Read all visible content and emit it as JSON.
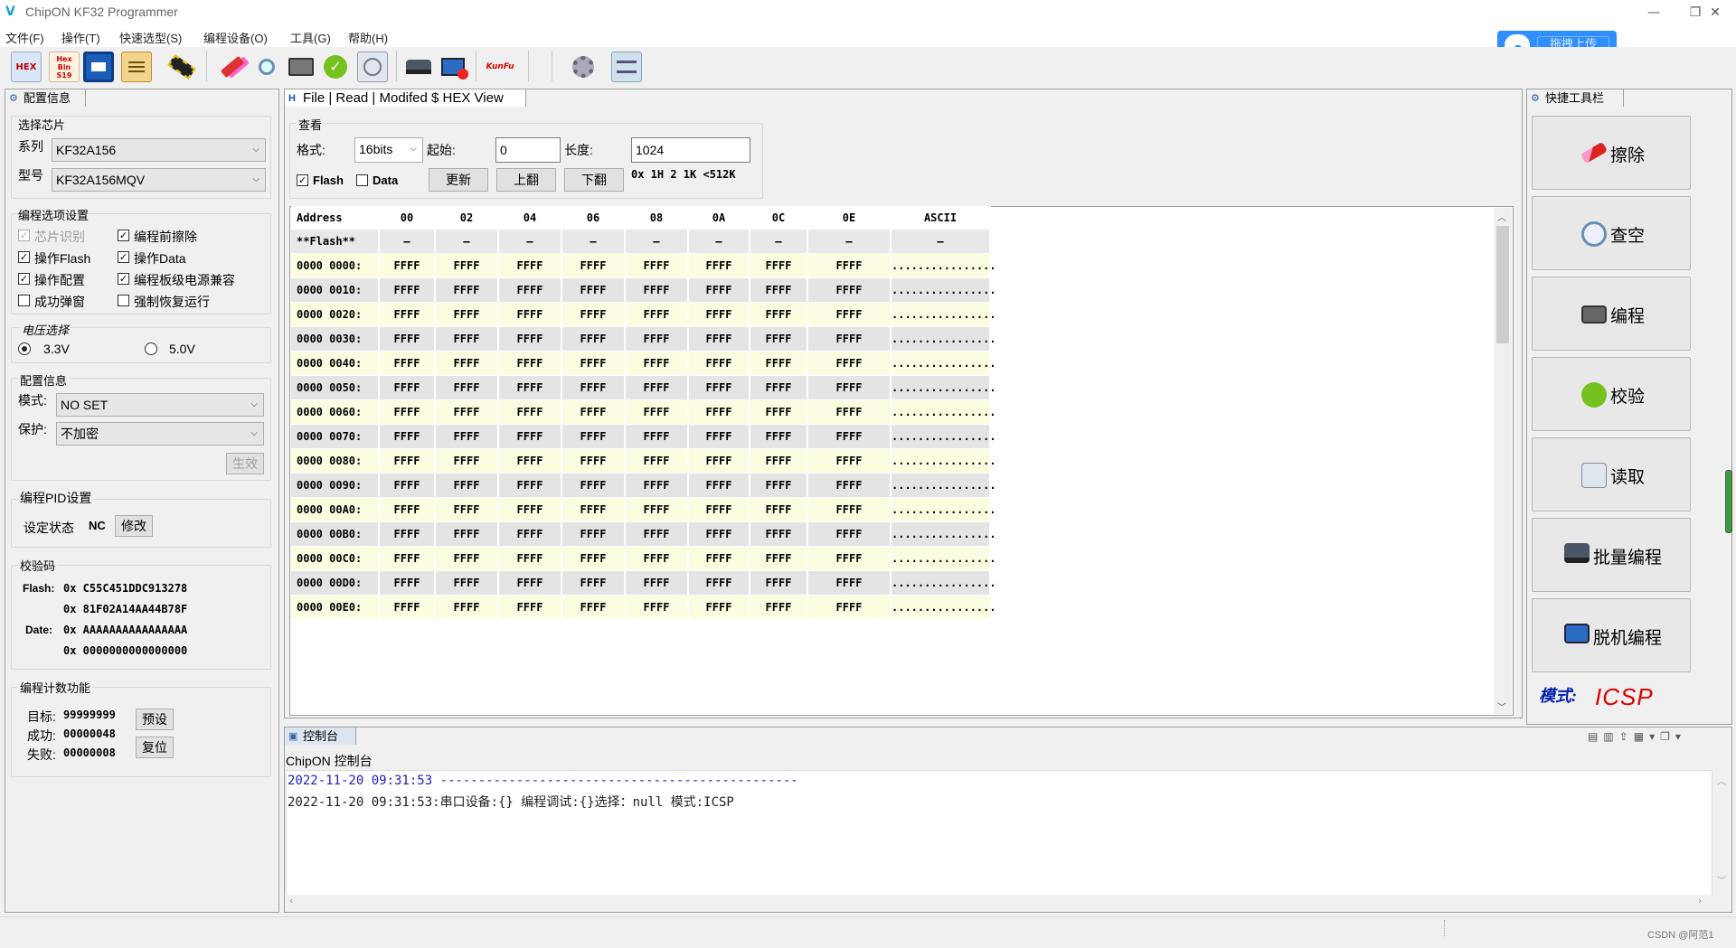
{
  "window": {
    "title": "ChipON KF32 Programmer",
    "minimize": "—",
    "maximize": "❐",
    "close": "✕"
  },
  "menu": [
    "文件(F)",
    "操作(T)",
    "快速选型(S)",
    "编程设备(O)",
    "工具(G)",
    "帮助(H)"
  ],
  "toolbar": {
    "icons": [
      "open-hex-icon",
      "hex-bin-icon",
      "save-icon",
      "report-icon",
      "chip-icon",
      "erase-icon",
      "blank-check-icon",
      "program-icon",
      "verify-icon",
      "read-icon",
      "batch-program-icon",
      "offline-program-icon",
      "kungfu-logo-icon",
      "settings-icon",
      "update-icon"
    ],
    "hex_label": "HEX",
    "hex_bin_label": "Hex Bin S19"
  },
  "upload": {
    "label": "拖拽上传"
  },
  "config": {
    "tab": "配置信息",
    "chip_group": "选择芯片",
    "series_label": "系列",
    "series_value": "KF32A156",
    "model_label": "型号",
    "model_value": "KF32A156MQV",
    "options_group": "编程选项设置",
    "options": [
      {
        "label": "芯片识别",
        "checked": true,
        "disabled": true
      },
      {
        "label": "编程前擦除",
        "checked": true,
        "disabled": false
      },
      {
        "label": "操作Flash",
        "checked": true,
        "disabled": false
      },
      {
        "label": "操作Data",
        "checked": true,
        "disabled": false
      },
      {
        "label": "操作配置",
        "checked": true,
        "disabled": false
      },
      {
        "label": "编程板级电源兼容",
        "checked": true,
        "disabled": false
      },
      {
        "label": "成功弹窗",
        "checked": false,
        "disabled": false
      },
      {
        "label": "强制恢复运行",
        "checked": false,
        "disabled": false
      }
    ],
    "voltage_group": "电压选择",
    "voltage_options": [
      "3.3V",
      "5.0V"
    ],
    "voltage_selected": "3.3V",
    "cfg_group": "配置信息",
    "mode_label": "模式:",
    "mode_value": "NO SET",
    "protect_label": "保护:",
    "protect_value": "不加密",
    "apply_button": "生效",
    "pid_group": "编程PID设置",
    "pid_state_label": "设定状态",
    "pid_state_value": "NC",
    "pid_modify": "修改",
    "checksum_group": "校验码",
    "flash_label": "Flash:",
    "flash_values": [
      "0x C55C451DDC913278",
      "0x 81F02A14AA44B78F"
    ],
    "date_label": "Date:",
    "date_values": [
      "0x AAAAAAAAAAAAAAAA",
      "0x 0000000000000000"
    ],
    "counter_group": "编程计数功能",
    "target_label": "目标:",
    "target_value": "99999999",
    "success_label": "成功:",
    "success_value": "00000048",
    "fail_label": "失败:",
    "fail_value": "00000008",
    "preset_button": "预设",
    "reset_button": "复位"
  },
  "hexview": {
    "tab": "File | Read | Modifed $ HEX View",
    "view_group": "查看",
    "format_label": "格式:",
    "format_value": "16bits",
    "start_label": "起始:",
    "start_value": "0",
    "length_label": "长度:",
    "length_value": "1024",
    "flash_cb": "Flash",
    "flash_checked": true,
    "data_cb": "Data",
    "data_checked": false,
    "refresh": "更新",
    "page_up": "上翻",
    "page_down": "下翻",
    "size_hint": "0x 1H 2 1K <512K",
    "columns": [
      "Address",
      "00",
      "02",
      "04",
      "06",
      "08",
      "0A",
      "0C",
      "0E",
      "ASCII"
    ],
    "section_row": [
      "**Flash**",
      "—",
      "—",
      "—",
      "—",
      "—",
      "—",
      "—",
      "—",
      "—"
    ],
    "rows": [
      {
        "addr": "0000 0000:",
        "cells": [
          "FFFF",
          "FFFF",
          "FFFF",
          "FFFF",
          "FFFF",
          "FFFF",
          "FFFF",
          "FFFF"
        ],
        "ascii": "................"
      },
      {
        "addr": "0000 0010:",
        "cells": [
          "FFFF",
          "FFFF",
          "FFFF",
          "FFFF",
          "FFFF",
          "FFFF",
          "FFFF",
          "FFFF"
        ],
        "ascii": "................"
      },
      {
        "addr": "0000 0020:",
        "cells": [
          "FFFF",
          "FFFF",
          "FFFF",
          "FFFF",
          "FFFF",
          "FFFF",
          "FFFF",
          "FFFF"
        ],
        "ascii": "................"
      },
      {
        "addr": "0000 0030:",
        "cells": [
          "FFFF",
          "FFFF",
          "FFFF",
          "FFFF",
          "FFFF",
          "FFFF",
          "FFFF",
          "FFFF"
        ],
        "ascii": "................"
      },
      {
        "addr": "0000 0040:",
        "cells": [
          "FFFF",
          "FFFF",
          "FFFF",
          "FFFF",
          "FFFF",
          "FFFF",
          "FFFF",
          "FFFF"
        ],
        "ascii": "................"
      },
      {
        "addr": "0000 0050:",
        "cells": [
          "FFFF",
          "FFFF",
          "FFFF",
          "FFFF",
          "FFFF",
          "FFFF",
          "FFFF",
          "FFFF"
        ],
        "ascii": "................"
      },
      {
        "addr": "0000 0060:",
        "cells": [
          "FFFF",
          "FFFF",
          "FFFF",
          "FFFF",
          "FFFF",
          "FFFF",
          "FFFF",
          "FFFF"
        ],
        "ascii": "................"
      },
      {
        "addr": "0000 0070:",
        "cells": [
          "FFFF",
          "FFFF",
          "FFFF",
          "FFFF",
          "FFFF",
          "FFFF",
          "FFFF",
          "FFFF"
        ],
        "ascii": "................"
      },
      {
        "addr": "0000 0080:",
        "cells": [
          "FFFF",
          "FFFF",
          "FFFF",
          "FFFF",
          "FFFF",
          "FFFF",
          "FFFF",
          "FFFF"
        ],
        "ascii": "................"
      },
      {
        "addr": "0000 0090:",
        "cells": [
          "FFFF",
          "FFFF",
          "FFFF",
          "FFFF",
          "FFFF",
          "FFFF",
          "FFFF",
          "FFFF"
        ],
        "ascii": "................"
      },
      {
        "addr": "0000 00A0:",
        "cells": [
          "FFFF",
          "FFFF",
          "FFFF",
          "FFFF",
          "FFFF",
          "FFFF",
          "FFFF",
          "FFFF"
        ],
        "ascii": "................"
      },
      {
        "addr": "0000 00B0:",
        "cells": [
          "FFFF",
          "FFFF",
          "FFFF",
          "FFFF",
          "FFFF",
          "FFFF",
          "FFFF",
          "FFFF"
        ],
        "ascii": "................"
      },
      {
        "addr": "0000 00C0:",
        "cells": [
          "FFFF",
          "FFFF",
          "FFFF",
          "FFFF",
          "FFFF",
          "FFFF",
          "FFFF",
          "FFFF"
        ],
        "ascii": "................"
      },
      {
        "addr": "0000 00D0:",
        "cells": [
          "FFFF",
          "FFFF",
          "FFFF",
          "FFFF",
          "FFFF",
          "FFFF",
          "FFFF",
          "FFFF"
        ],
        "ascii": "................"
      },
      {
        "addr": "0000 00E0:",
        "cells": [
          "FFFF",
          "FFFF",
          "FFFF",
          "FFFF",
          "FFFF",
          "FFFF",
          "FFFF",
          "FFFF"
        ],
        "ascii": "................"
      }
    ],
    "row_colors": {
      "odd": "#fbfce0",
      "even": "#e4e4e4",
      "header": "#e8e8e8"
    }
  },
  "quick": {
    "tab": "快捷工具栏",
    "buttons": [
      {
        "label": "擦除",
        "icon": "eraser-icon"
      },
      {
        "label": "查空",
        "icon": "magnifier-icon"
      },
      {
        "label": "编程",
        "icon": "program-device-icon"
      },
      {
        "label": "校验",
        "icon": "check-circle-icon"
      },
      {
        "label": "读取",
        "icon": "read-device-icon"
      },
      {
        "label": "批量编程",
        "icon": "batch-device-icon"
      },
      {
        "label": "脱机编程",
        "icon": "offline-device-icon"
      }
    ],
    "mode_label": "模式:",
    "mode_value": "ICSP",
    "mode_color": "#e00000"
  },
  "console": {
    "tab": "控制台",
    "title": "ChipON 控制台",
    "lines": [
      {
        "text": "2022-11-20 09:31:53 -----------------------------------------------",
        "color": "#2020c0"
      },
      {
        "text": "2022-11-20 09:31:53:串口设备:{} 编程调试:{}选择：null 模式:ICSP",
        "color": "#222222"
      }
    ]
  },
  "watermark": "CSDN @阿范1"
}
